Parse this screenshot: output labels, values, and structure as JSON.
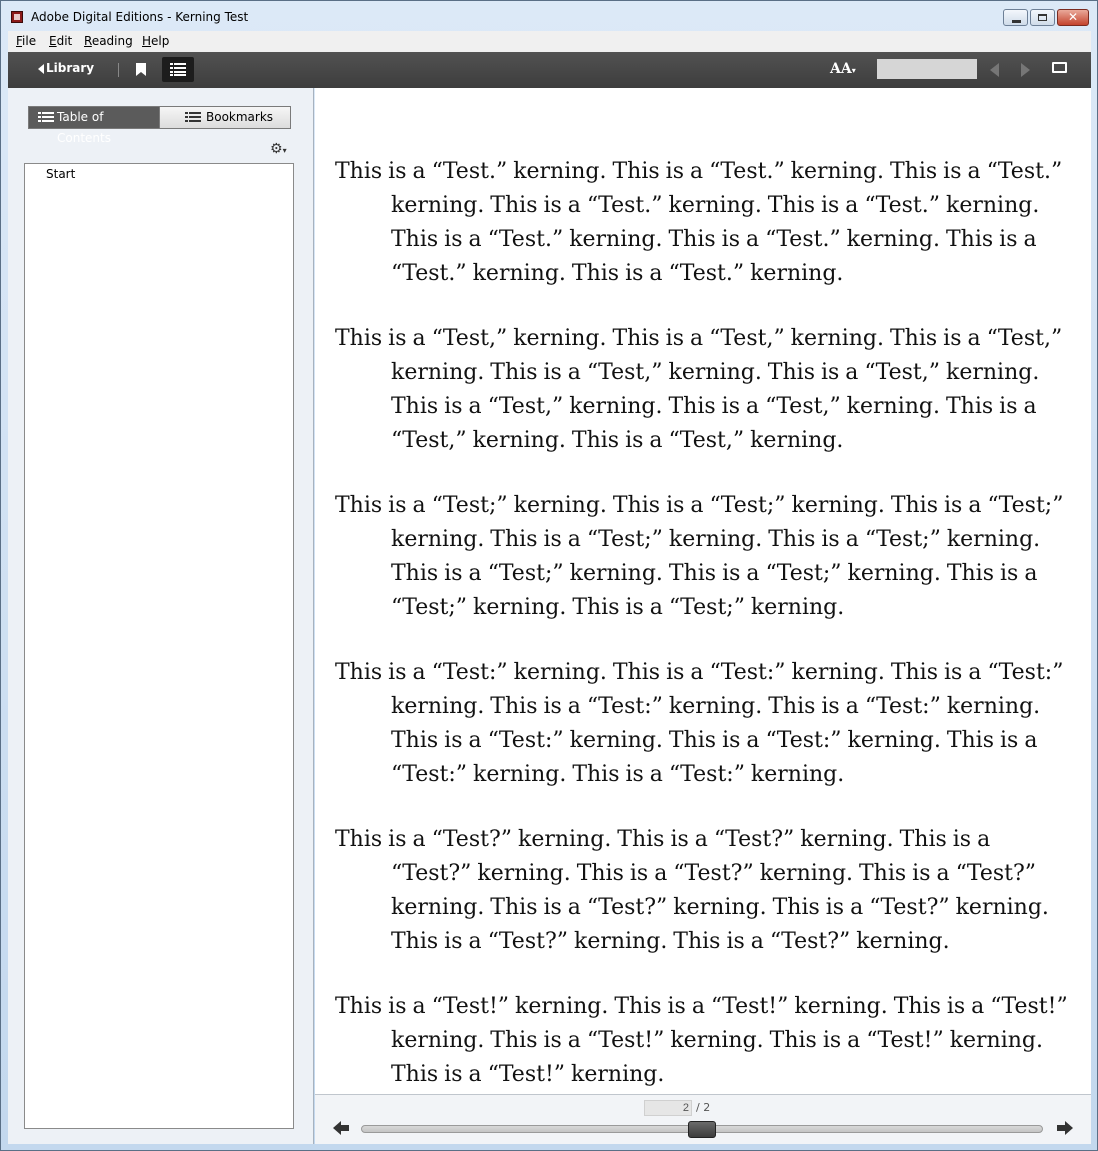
{
  "window": {
    "title": "Adobe Digital Editions - Kerning Test",
    "close_glyph": "✕"
  },
  "menu": [
    {
      "label": "File",
      "accel": "F",
      "rest": "ile"
    },
    {
      "label": "Edit",
      "accel": "E",
      "rest": "dit"
    },
    {
      "label": "Reading",
      "accel": "R",
      "rest": "eading"
    },
    {
      "label": "Help",
      "accel": "H",
      "rest": "elp"
    }
  ],
  "toolbar": {
    "library_label": "Library",
    "font_size_label": "AA",
    "search_value": ""
  },
  "sidebar": {
    "tabs": [
      "Table of Contents",
      "Bookmarks"
    ],
    "toc_entries": [
      "Start"
    ]
  },
  "content": {
    "paragraphs": [
      "This is a “Test.” kerning. This is a “Test.” kerning. This is a “Test.” kerning. This is a “Test.” kerning. This is a “Test.” kerning. This is a “Test.” kerning. This is a “Test.” kerning. This is a “Test.” kerning. This is a “Test.” kerning.",
      "This is a “Test,” kerning. This is a “Test,” kerning. This is a “Test,” kerning. This is a “Test,” kerning. This is a “Test,” kerning. This is a “Test,” kerning. This is a “Test,” kerning. This is a “Test,” kerning. This is a “Test,” kerning.",
      "This is a “Test;” kerning. This is a “Test;” kerning. This is a “Test;” kerning. This is a “Test;” kerning. This is a “Test;” kerning. This is a “Test;” kerning. This is a “Test;” kerning. This is a “Test;” kerning. This is a “Test;” kerning.",
      "This is a “Test:” kerning. This is a “Test:” kerning. This is a “Test:” kerning. This is a “Test:” kerning. This is a “Test:” kerning. This is a “Test:” kerning. This is a “Test:” kerning. This is a “Test:” kerning. This is a “Test:” kerning.",
      "This is a “Test?” kerning. This is a “Test?” kerning. This is a “Test?” kerning. This is a “Test?” kerning. This is a “Test?” kerning. This is a “Test?” kerning. This is a “Test?” kerning. This is a “Test?” kerning. This is a “Test?” kerning.",
      "This is a “Test!” kerning. This is a “Test!” kerning. This is a “Test!” kerning. This is a “Test!” kerning. This is a “Test!” kerning. This is a “Test!” kerning."
    ]
  },
  "pagination": {
    "current_page": "2",
    "total_pages": "/ 2",
    "progress": 0.5
  }
}
